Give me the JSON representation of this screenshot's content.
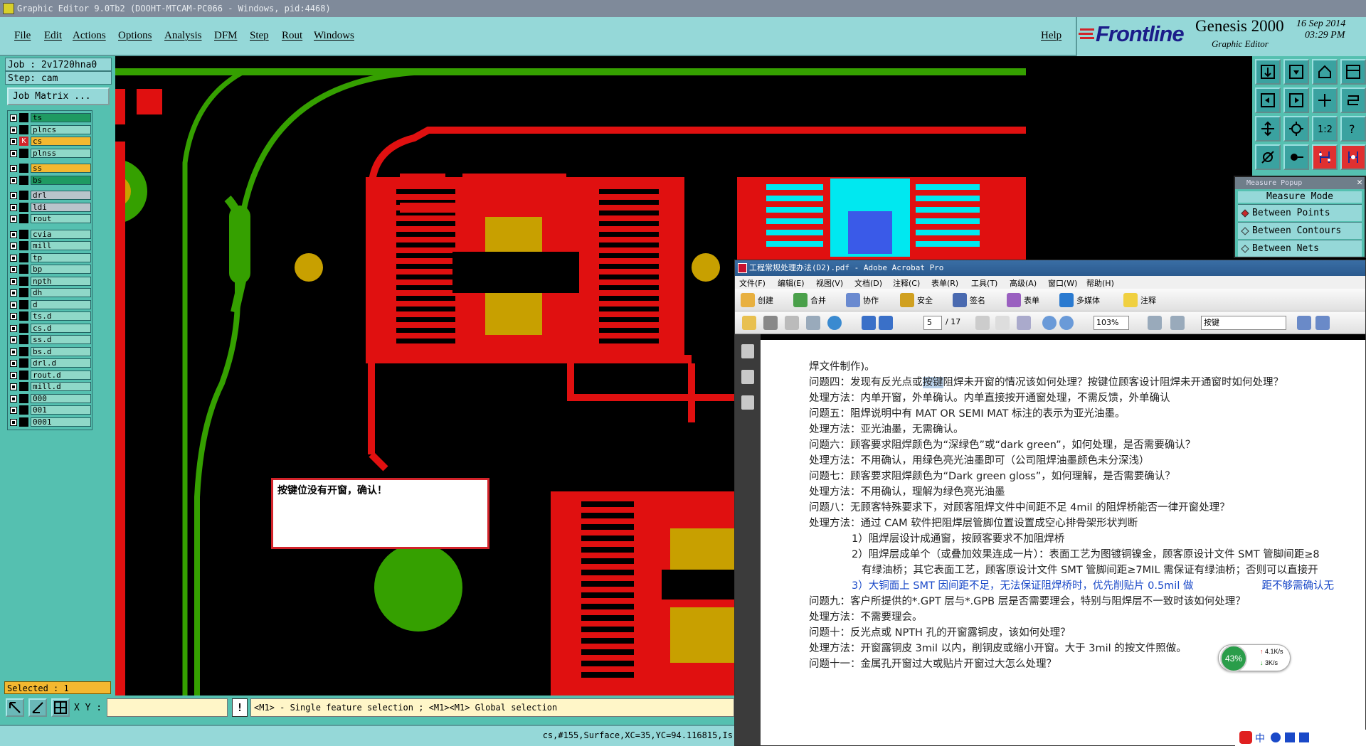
{
  "window": {
    "title": "Graphic Editor 9.0Tb2 (DOOHT-MTCAM-PC066 - Windows, pid:4468)"
  },
  "menu": {
    "items": [
      "File",
      "Edit",
      "Actions",
      "Options",
      "Analysis",
      "DFM",
      "Step",
      "Rout",
      "Windows"
    ],
    "help": "Help"
  },
  "brand": {
    "logo": "Frontline",
    "product": "Genesis 2000",
    "subtitle": "Graphic Editor",
    "date": "16 Sep 2014",
    "time": "03:29 PM"
  },
  "job": {
    "job": "Job  : 2v1720hna0",
    "step": "Step: cam",
    "matrix_button": "Job Matrix ..."
  },
  "layers": [
    {
      "name": "ts",
      "color": "gr"
    },
    {
      "name": "plncs",
      "color": "tl"
    },
    {
      "name": "cs",
      "color": "yl",
      "active": true
    },
    {
      "name": "plnss",
      "color": "tl"
    },
    {
      "name": "ss",
      "color": "yl"
    },
    {
      "name": "bs",
      "color": "gr"
    },
    {
      "name": "drl",
      "color": "gy"
    },
    {
      "name": "ldi",
      "color": "gy"
    },
    {
      "name": "rout",
      "color": "tl"
    },
    {
      "name": "cvia",
      "color": "tl"
    },
    {
      "name": "mill",
      "color": "tl"
    },
    {
      "name": "tp",
      "color": "tl"
    },
    {
      "name": "bp",
      "color": "tl"
    },
    {
      "name": "npth",
      "color": "tl"
    },
    {
      "name": "dh",
      "color": "tl"
    },
    {
      "name": "d",
      "color": "tl"
    },
    {
      "name": "ts.d",
      "color": "tl"
    },
    {
      "name": "cs.d",
      "color": "tl"
    },
    {
      "name": "ss.d",
      "color": "tl"
    },
    {
      "name": "bs.d",
      "color": "tl"
    },
    {
      "name": "drl.d",
      "color": "tl"
    },
    {
      "name": "rout.d",
      "color": "tl"
    },
    {
      "name": "mill.d",
      "color": "tl"
    },
    {
      "name": "000",
      "color": "tl"
    },
    {
      "name": "001",
      "color": "tl"
    },
    {
      "name": "0001",
      "color": "tl"
    }
  ],
  "selected": "Selected : 1",
  "bottom": {
    "xy_label": "X Y :",
    "xy_value": "",
    "hint": "<M1> - Single feature selection ; <M1><M1> Global selection",
    "status": "cs,#155,Surface,XC=35,YC=94.116815,Is"
  },
  "dialog": {
    "text": "按键位没有开窗，确认！"
  },
  "measure": {
    "title": "Measure Popup",
    "header": "Measure Mode",
    "options": [
      "Between Points",
      "Between Contours",
      "Between Nets"
    ]
  },
  "acrobat": {
    "title": "工程常规处理办法(D2).pdf - Adobe Acrobat Pro",
    "menu": [
      "文件(F)",
      "编辑(E)",
      "视图(V)",
      "文档(D)",
      "注释(C)",
      "表单(R)",
      "工具(T)",
      "高级(A)",
      "窗口(W)",
      "帮助(H)"
    ],
    "toolbar": [
      "创建",
      "合并",
      "协作",
      "安全",
      "签名",
      "表单",
      "多媒体",
      "注释"
    ],
    "page_current": "5",
    "page_total": "/ 17",
    "zoom": "103%",
    "search": "按键",
    "lines": [
      {
        "t": "焊文件制作)。",
        "c": ""
      },
      {
        "t": "问题四：发现有反光点或",
        "h": "按键",
        "r": "阻焊未开窗的情况该如何处理？按键位顾客设计阻焊未开通窗时如何处理？",
        "c": ""
      },
      {
        "t": "处理方法：内单开窗，外单确认。内单直接按开通窗处理，不需反馈，外单确认",
        "c": ""
      },
      {
        "t": "问题五：阻焊说明中有 MAT OR SEMI MAT 标注的表示为亚光油墨。",
        "c": ""
      },
      {
        "t": "处理方法：亚光油墨，无需确认。",
        "c": ""
      },
      {
        "t": "问题六：顾客要求阻焊颜色为“深绿色”或“dark green”，如何处理，是否需要确认？",
        "c": ""
      },
      {
        "t": "处理方法：不用确认，用绿色亮光油墨即可（公司阻焊油墨颜色未分深浅）",
        "c": ""
      },
      {
        "t": "问题七：顾客要求阻焊颜色为“Dark green gloss”，如何理解，是否需要确认？",
        "c": ""
      },
      {
        "t": "处理方法：不用确认，理解为绿色亮光油墨",
        "c": ""
      },
      {
        "t": "问题八：无顾客特殊要求下，对顾客阻焊文件中间距不足 4mil 的阻焊桥能否一律开窗处理？",
        "c": ""
      },
      {
        "t": "处理方法：通过 CAM 软件把阻焊层管脚位置设置成空心排骨架形状判断",
        "c": ""
      },
      {
        "t": "1）阻焊层设计成通窗，按顾客要求不加阻焊桥",
        "c": "ind"
      },
      {
        "t": "2）阻焊层成单个（或叠加效果连成一片）：表面工艺为图镀铜镍金，顾客原设计文件 SMT 管脚间距≥8",
        "c": "ind"
      },
      {
        "t": "有绿油桥；其它表面工艺，顾客原设计文件 SMT 管脚间距≥7MIL 需保证有绿油桥；否则可以直接开",
        "c": "ind2"
      },
      {
        "t": "3）大铜面上 SMT 因间距不足，无法保证阻焊桥时，优先削贴片 0.5mil 做",
        "r2": "距不够需确认无",
        "c": "ind blue"
      },
      {
        "t": "问题九：客户所提供的*.GPT 层与*.GPB 层是否需要理会，特别与阻焊层不一致时该如何处理？",
        "c": ""
      },
      {
        "t": "处理方法：不需要理会。",
        "c": ""
      },
      {
        "t": "问题十：反光点或 NPTH 孔的开窗露铜皮，该如何处理？",
        "c": ""
      },
      {
        "t": "处理方法：开窗露铜皮 3mil 以内，削铜皮或缩小开窗。大于 3mil 的按文件照做。",
        "c": ""
      },
      {
        "t": "问题十一：金属孔开窗过大或贴片开窗过大怎么处理？",
        "c": ""
      }
    ]
  },
  "netwidget": {
    "percent": "43%",
    "up": "4.1K/s",
    "down": "3K/s"
  },
  "colors": {
    "cyan_panel": "#95d8d8",
    "teal_panel": "#55c0b0",
    "copper": "#e01010",
    "trace_green": "#2e8b00",
    "pad_gold": "#c8a000",
    "cyan_pad": "#00e8f0"
  }
}
